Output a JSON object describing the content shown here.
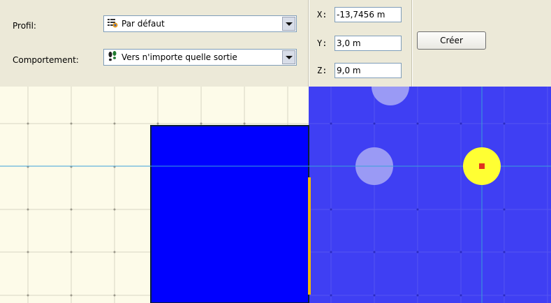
{
  "panel": {
    "profile_label": "Profil:",
    "profile_value": "Par défaut",
    "profile_icon": "profile-list-icon",
    "behavior_label": "Comportement:",
    "behavior_value": "Vers n'importe quelle sortie",
    "behavior_icon": "footprints-icon",
    "dropdown_icon": "chevron-down-icon"
  },
  "coords": {
    "x_label": "X:",
    "x_value": "-13,7456 m",
    "y_label": "Y:",
    "y_value": "3,0 m",
    "z_label": "Z:",
    "z_value": "9,0 m"
  },
  "actions": {
    "create_label": "Créer"
  },
  "viewport": {
    "left_background": "#fdfbe9",
    "right_background": "#3f3ff3",
    "block_color": "#0000ff",
    "door_color": "#f2b705",
    "crosshair_color": "#3aa0d9",
    "agent_color": "#ffff33",
    "agent_center_color": "#e03020",
    "ghost_color": "#9a9af5"
  }
}
